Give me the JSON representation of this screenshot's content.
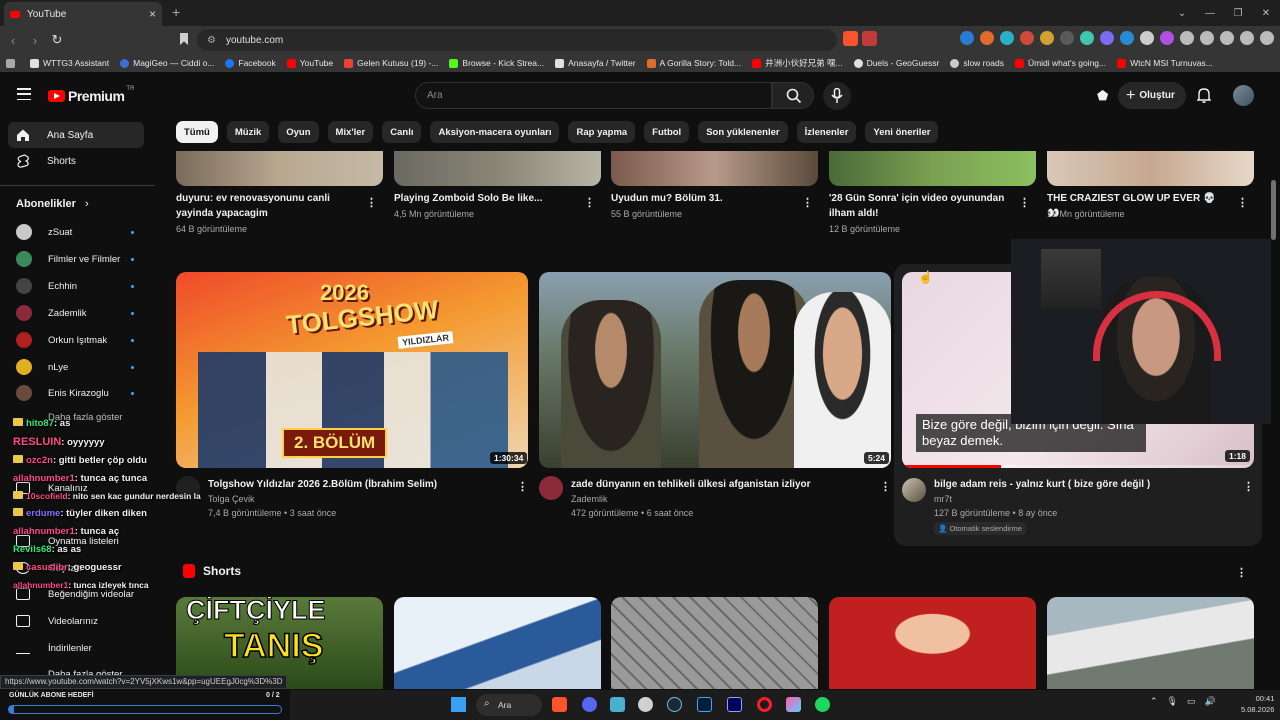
{
  "browser": {
    "tab_title": "YouTube",
    "url": "youtube.com",
    "status_url": "https://www.youtube.com/watch?v=2YV5jXKws1w&pp=ugUEEgJ0cg%3D%3D",
    "bookmarks": [
      "WTTG3 Assistant",
      "MagiGeo — Ciddi o...",
      "Facebook",
      "YouTube",
      "Gelen Kutusu (19) -...",
      "Browse - Kick Strea...",
      "Anasayfa / Twitter",
      "A Gorilla Story: Told...",
      "井洲小伙好兄弟 嘿...",
      "Duels - GeoGuessr",
      "slow roads",
      "Ümidi what's going...",
      "WtcN MSI Turnuvas..."
    ]
  },
  "header": {
    "logo_text": "Premium",
    "logo_region": "TR",
    "search_placeholder": "Ara",
    "create_label": "Oluştur"
  },
  "chips": [
    "Tümü",
    "Müzik",
    "Oyun",
    "Mix'ler",
    "Canlı",
    "Aksiyon-macera oyunları",
    "Rap yapma",
    "Futbol",
    "Son yüklenenler",
    "İzlenenler",
    "Yeni öneriler"
  ],
  "sidebar": {
    "home": "Ana Sayfa",
    "shorts": "Shorts",
    "subscriptions_title": "Abonelikler",
    "subscriptions": [
      {
        "name": "zSuat",
        "color": "#c9c9c9"
      },
      {
        "name": "Filmler ve Filmler",
        "color": "#3b8a5a"
      },
      {
        "name": "Echhin",
        "color": "#444444"
      },
      {
        "name": "Zademlik",
        "color": "#8a2a3a"
      },
      {
        "name": "Orkun Işıtmak",
        "color": "#b02020"
      },
      {
        "name": "nLye",
        "color": "#e0b020"
      },
      {
        "name": "Enis Kirazoglu",
        "color": "#6a4a3a"
      }
    ],
    "show_more": "Daha fazla göster",
    "lower": [
      "Kanalınız",
      "Oynatma listeleri",
      "Geç izle",
      "Beğendiğim videolar",
      "Videolarınız",
      "İndirilenler",
      "Daha fazla göster"
    ]
  },
  "row1": [
    {
      "title": "duyuru: ev renovasyonunu canli yayinda yapacagim",
      "meta": "64 B görüntüleme"
    },
    {
      "title": "Playing Zomboid Solo Be like...",
      "meta": "4,5 Mn görüntüleme"
    },
    {
      "title": "Uyudun mu? Bölüm 31.",
      "meta": "55 B görüntüleme"
    },
    {
      "title": "'28 Gün Sonra' için video oyunundan ilham aldı!",
      "meta": "12 B görüntüleme"
    },
    {
      "title": "THE CRAZIEST GLOW UP EVER 💀 👀",
      "meta": "13 Mn görüntüleme"
    }
  ],
  "row2": [
    {
      "title": "Tolgshow Yıldızlar 2026 2.Bölüm (İbrahim Selim)",
      "channel": "Tolga Çevik",
      "meta": "7,4 B görüntüleme • 3 saat önce",
      "duration": "1:30:34",
      "thumb_text1": "2026",
      "thumb_text2": "TOLGSHOW",
      "thumb_text3": "YILDIZLAR",
      "thumb_text4": "2. BÖLÜM"
    },
    {
      "title": "zade dünyanın en tehlikeli ülkesi afganistan izliyor",
      "channel": "Zademlik",
      "meta": "472 görüntüleme • 6 saat önce",
      "duration": "5:24"
    },
    {
      "title": "bilge adam reis - yalnız kurt ( bize göre değil )",
      "channel": "mr7t",
      "meta": "127 B görüntüleme • 8 ay önce",
      "duration": "1:18",
      "caption": "Bize göre değil, bizim için değil. Sına beyaz demek.",
      "badge": "Otomatik seslendirme"
    }
  ],
  "shorts": {
    "title": "Shorts",
    "first_text1": "ÇİFTÇİYLE",
    "first_text2": "TANIŞ"
  },
  "chat": [
    {
      "user": "hito87",
      "msg": ": as",
      "color": "#2ee87a"
    },
    {
      "user": "RESLUIN",
      "msg": ": oyyyyyy",
      "color": "#ff4a8a"
    },
    {
      "user": "ozc2n",
      "msg": ": gitti betler çöp oldu",
      "color": "#ff4a8a"
    },
    {
      "user": "allahnumber1",
      "msg": ": tunca aç tunca",
      "color": "#ff4a8a"
    },
    {
      "user": "10scofield",
      "msg": ": nito sen kac gundur nerdesin la",
      "color": "#ff4a8a"
    },
    {
      "user": "erdume",
      "msg": ": tüyler diken diken",
      "color": "#8a6cff"
    },
    {
      "user": "allahnumber1",
      "msg": ": tunca aç",
      "color": "#ff4a8a"
    },
    {
      "user": "Revils68",
      "msg": ": as as",
      "color": "#2ee87a"
    },
    {
      "user": "casuslibr",
      "msg": ": geoguessr",
      "color": "#ff4a8a"
    },
    {
      "user": "allahnumber1",
      "msg": ": tunca izleyek tınca",
      "color": "#ff4a8a"
    }
  ],
  "goal": {
    "label": "GÜNLÜK ABONE HEDEFİ",
    "count": "0 / 2",
    "progress": 0.02
  },
  "taskbar": {
    "search": "Ara",
    "time": "00:41",
    "date": "5.08.2026"
  },
  "colors": {
    "accent": "#ff0000",
    "link_blue": "#3ea6ff",
    "goal_blue": "#3a7bd5"
  }
}
